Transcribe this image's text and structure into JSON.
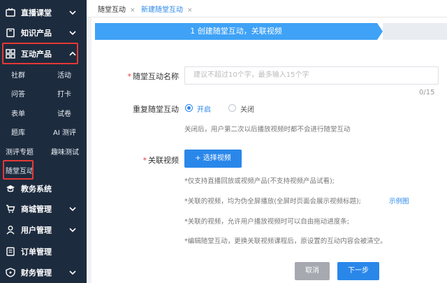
{
  "sidebar": {
    "items": [
      {
        "label": "直播课堂",
        "icon": "tv-icon"
      },
      {
        "label": "知识产品",
        "icon": "book-icon"
      },
      {
        "label": "互动产品",
        "icon": "grid-icon"
      },
      {
        "label": "教务系统",
        "icon": "mortarboard-icon"
      },
      {
        "label": "商城管理",
        "icon": "cart-icon"
      },
      {
        "label": "用户管理",
        "icon": "user-icon"
      },
      {
        "label": "订单管理",
        "icon": "order-icon"
      },
      {
        "label": "财务管理",
        "icon": "finance-icon"
      }
    ],
    "sub_items": [
      "社群",
      "活动",
      "问答",
      "打卡",
      "表单",
      "试卷",
      "题库",
      "AI 测评",
      "测评专题",
      "趣味测试",
      "随堂互动"
    ]
  },
  "tabs": [
    {
      "label": "随堂互动",
      "close": "×"
    },
    {
      "label": "新建随堂互动",
      "close": "×"
    }
  ],
  "step": {
    "label": "1 创建随堂互动，关联视频"
  },
  "form": {
    "name_label": "随堂互动名称",
    "name_required": "*",
    "name_placeholder": "建议不超过10个字，最多输入15个字",
    "name_counter": "0/15",
    "repeat_label": "重复随堂互动",
    "repeat_on": "开启",
    "repeat_off": "关闭",
    "repeat_hint": "关闭后，用户第二次以后播放视频时都不会进行随堂互动",
    "video_label": "关联视频",
    "video_required": "*",
    "choose_button": "+ 选择视频",
    "notes": [
      "*仅支持直播回放或视频产品(不支持视频产品试看);",
      "*关联的视频，均为伪全屏播放(全屏时页面会展示视频标题);",
      "*关联的视频，允许用户播放视频时可以自由拖动进度条;",
      "*编辑随堂互动，更换关联视频课程后，原设置的互动内容会被清空。"
    ],
    "example_link": "示例图"
  },
  "buttons": {
    "cancel": "取消",
    "next": "下一步"
  },
  "colors": {
    "sidebar_bg": "#1d2b3e",
    "primary": "#2a87ea",
    "highlight": "#e53935"
  }
}
